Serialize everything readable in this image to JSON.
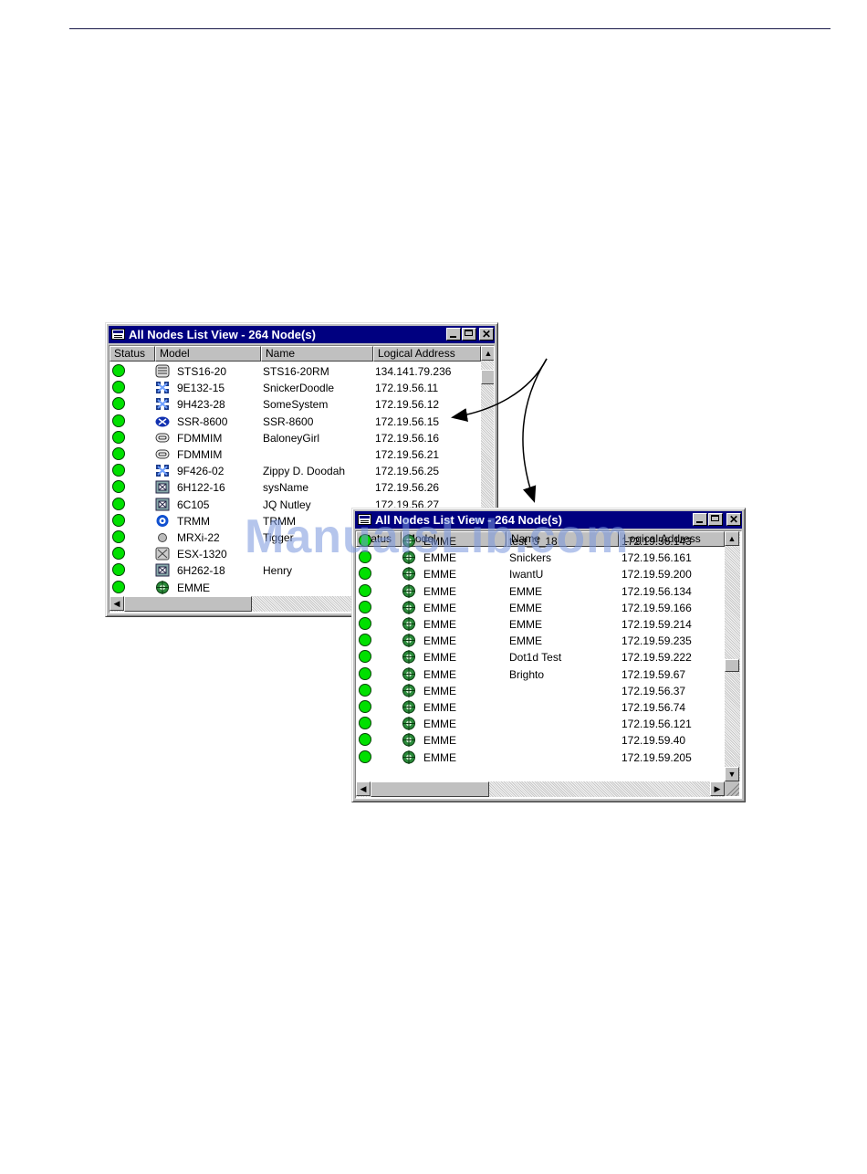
{
  "window1": {
    "title": "All Nodes List View - 264 Node(s)",
    "columns": [
      "Status",
      "Model",
      "Name",
      "Logical Address"
    ],
    "rows": [
      {
        "icon": "sts-device-icon",
        "model": "STS16-20",
        "name": "STS16-20RM",
        "address": "134.141.79.236"
      },
      {
        "icon": "switch-icon",
        "model": "9E132-15",
        "name": "SnickerDoodle",
        "address": "172.19.56.11"
      },
      {
        "icon": "switch-icon",
        "model": "9H423-28",
        "name": "SomeSystem",
        "address": "172.19.56.12"
      },
      {
        "icon": "router-icon",
        "model": "SSR-8600",
        "name": "SSR-8600",
        "address": "172.19.56.15"
      },
      {
        "icon": "link-icon",
        "model": "FDMMIM",
        "name": "BaloneyGirl",
        "address": "172.19.56.16"
      },
      {
        "icon": "link-icon",
        "model": "FDMMIM",
        "name": "",
        "address": "172.19.56.21"
      },
      {
        "icon": "switch-icon",
        "model": "9F426-02",
        "name": "Zippy D. Doodah",
        "address": "172.19.56.25"
      },
      {
        "icon": "chassis-icon",
        "model": "6H122-16",
        "name": "sysName",
        "address": "172.19.56.26"
      },
      {
        "icon": "chassis-icon",
        "model": "6C105",
        "name": "JQ Nutley",
        "address": "172.19.56.27"
      },
      {
        "icon": "ring-icon",
        "model": "TRMM",
        "name": "TRMM",
        "address": ""
      },
      {
        "icon": "small-node-icon",
        "model": "MRXi-22",
        "name": "Tigger",
        "address": ""
      },
      {
        "icon": "hub-icon",
        "model": "ESX-1320",
        "name": "",
        "address": ""
      },
      {
        "icon": "chassis-icon",
        "model": "6H262-18",
        "name": "Henry",
        "address": ""
      },
      {
        "icon": "emme-icon",
        "model": "EMME",
        "name": "",
        "address": ""
      }
    ]
  },
  "window2": {
    "title": "All Nodes List View - 264 Node(s)",
    "columns": [
      "Status",
      "Model",
      "Name",
      "Logical Address"
    ],
    "rows": [
      {
        "model": "EMME",
        "name": "test_3_18",
        "address": "172.19.56.143"
      },
      {
        "model": "EMME",
        "name": "Snickers",
        "address": "172.19.56.161"
      },
      {
        "model": "EMME",
        "name": "IwantU",
        "address": "172.19.59.200"
      },
      {
        "model": "EMME",
        "name": "EMME",
        "address": "172.19.56.134"
      },
      {
        "model": "EMME",
        "name": "EMME",
        "address": "172.19.59.166"
      },
      {
        "model": "EMME",
        "name": "EMME",
        "address": "172.19.59.214"
      },
      {
        "model": "EMME",
        "name": "EMME",
        "address": "172.19.59.235"
      },
      {
        "model": "EMME",
        "name": "Dot1d Test",
        "address": "172.19.59.222"
      },
      {
        "model": "EMME",
        "name": "Brighto",
        "address": "172.19.59.67"
      },
      {
        "model": "EMME",
        "name": "",
        "address": "172.19.56.37"
      },
      {
        "model": "EMME",
        "name": "",
        "address": "172.19.56.74"
      },
      {
        "model": "EMME",
        "name": "",
        "address": "172.19.56.121"
      },
      {
        "model": "EMME",
        "name": "",
        "address": "172.19.59.40"
      },
      {
        "model": "EMME",
        "name": "",
        "address": "172.19.59.205"
      }
    ]
  },
  "watermark": "ManualsLib.com",
  "colors": {
    "titlebar": "#000080",
    "status_ok": "#00e000",
    "chrome": "#c0c0c0"
  }
}
